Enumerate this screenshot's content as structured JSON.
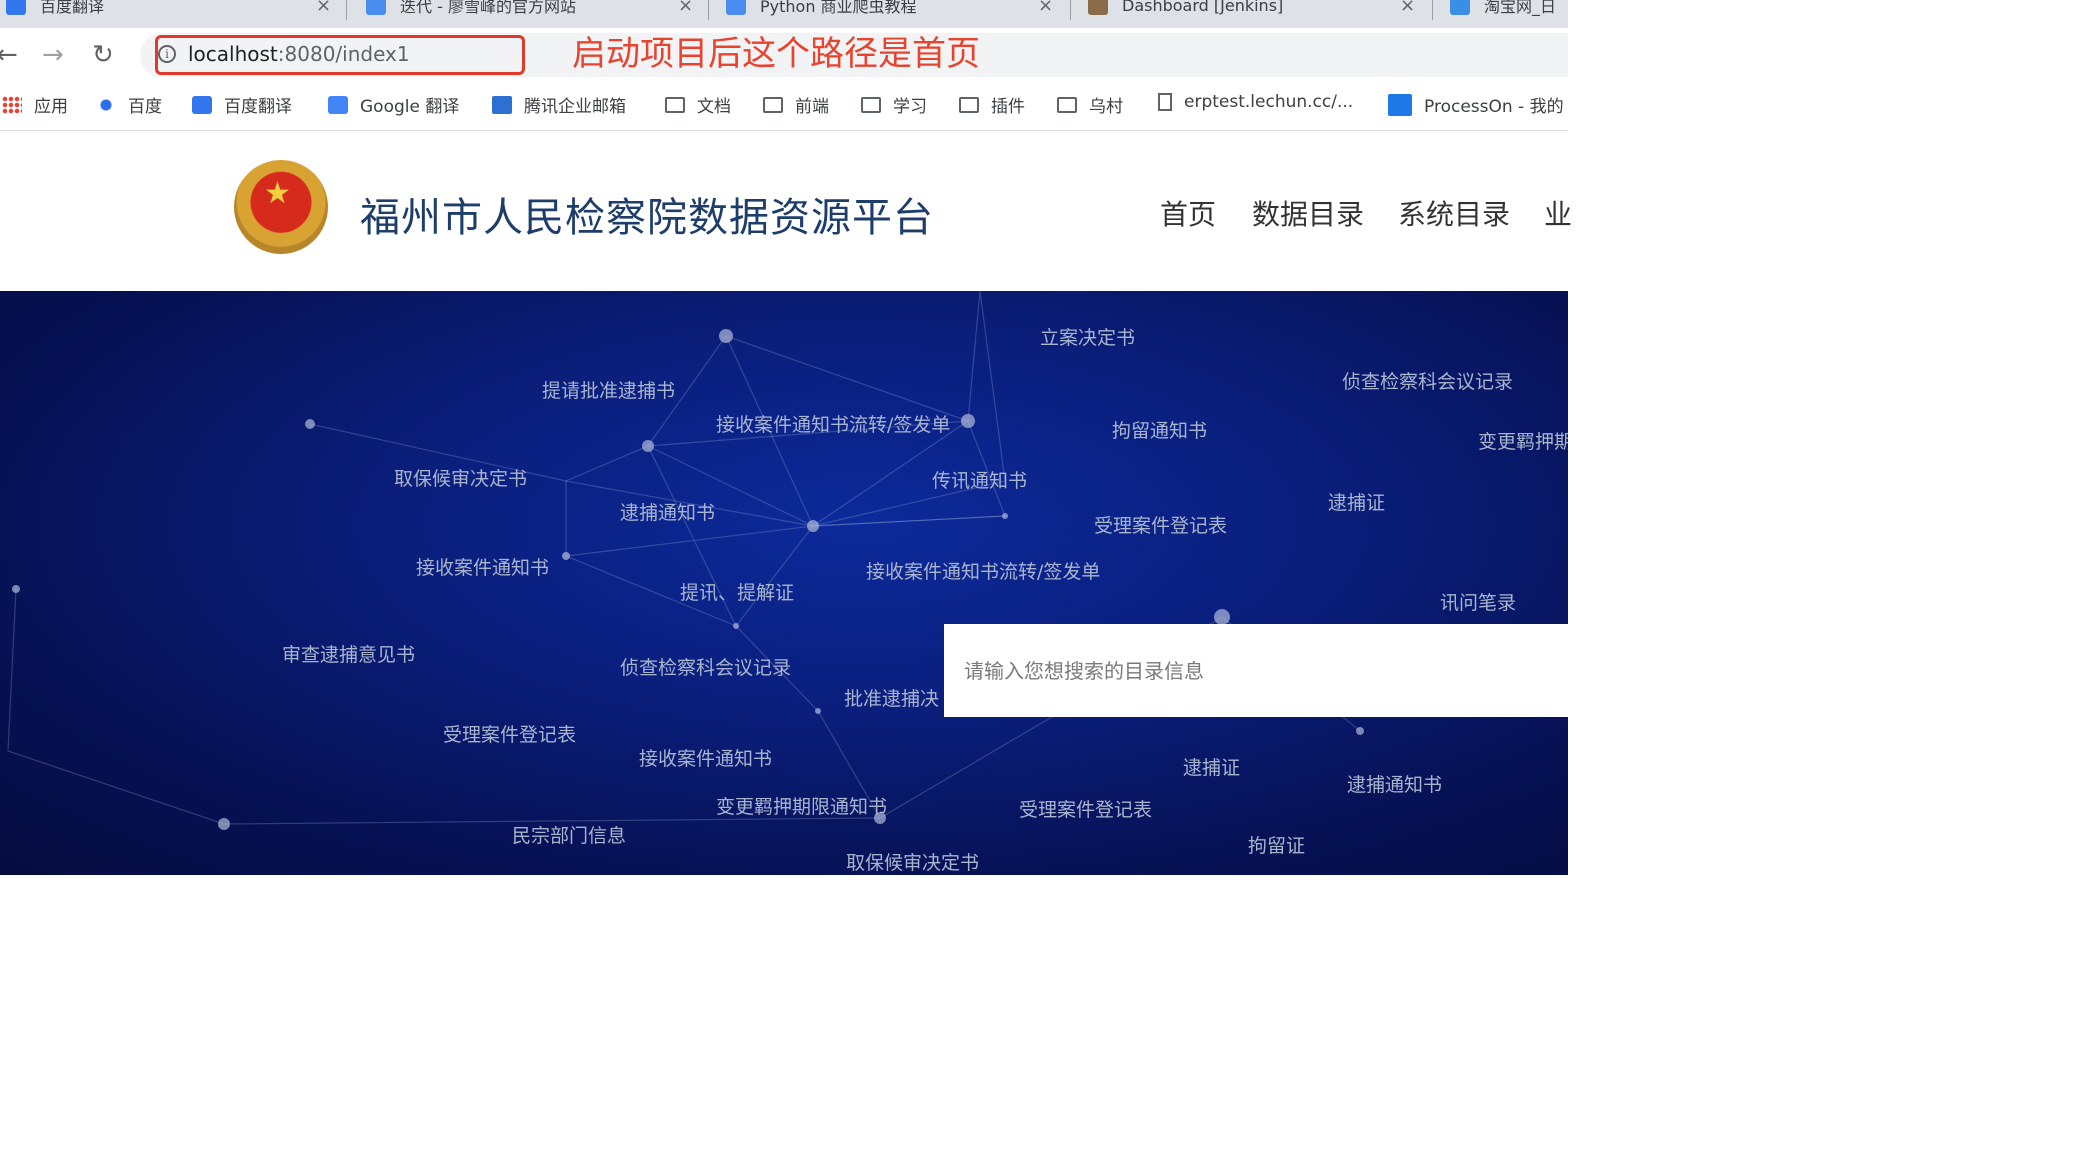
{
  "tabs": [
    {
      "label": "百度翻译",
      "color": "#3377ee"
    },
    {
      "label": "迭代 - 廖雪峰的官方网站",
      "color": "#4a8df0"
    },
    {
      "label": "Python 商业爬虫教程",
      "color": "#4a8df0"
    },
    {
      "label": "Dashboard [Jenkins]",
      "color": "#8a6b4a"
    },
    {
      "label": "淘宝网_日",
      "color": "#3a8ee6"
    }
  ],
  "tab_close": "×",
  "toolbar": {
    "back": "←",
    "forward": "→",
    "reload": "↻",
    "info": "i"
  },
  "address": {
    "host": "localhost",
    "rest": ":8080/index1"
  },
  "annotation": "启动项目后这个路径是首页",
  "bookmarks": [
    {
      "label": "应用"
    },
    {
      "label": "百度"
    },
    {
      "label": "百度翻译"
    },
    {
      "label": "Google 翻译"
    },
    {
      "label": "腾讯企业邮箱"
    },
    {
      "label": "文档"
    },
    {
      "label": "前端"
    },
    {
      "label": "学习"
    },
    {
      "label": "插件"
    },
    {
      "label": "乌村"
    },
    {
      "label": "erptest.lechun.cc/..."
    },
    {
      "label": "ProcessOn - 我的"
    }
  ],
  "site": {
    "title": "福州市人民检察院数据资源平台",
    "star": "★"
  },
  "nav": [
    "首页",
    "数据目录",
    "系统目录",
    "业"
  ],
  "words": [
    "立案决定书",
    "侦查检察科会议记录",
    "提请批准逮捕书",
    "接收案件通知书流转/签发单",
    "拘留通知书",
    "变更羁押期",
    "取保候审决定书",
    "传讯通知书",
    "逮捕证",
    "受理案件登记表",
    "逮捕通知书",
    "接收案件通知书",
    "接收案件通知书流转/签发单",
    "提讯、提解证",
    "讯问笔录",
    "审查逮捕意见书",
    "侦查检察科会议记录",
    "批准逮捕决",
    "受理案件登记表",
    "接收案件通知书",
    "逮捕证",
    "逮捕通知书",
    "变更羁押期限通知书",
    "受理案件登记表",
    "民宗部门信息",
    "拘留证",
    "取保候审决定书"
  ],
  "search": {
    "placeholder": "请输入您想搜索的目录信息"
  }
}
